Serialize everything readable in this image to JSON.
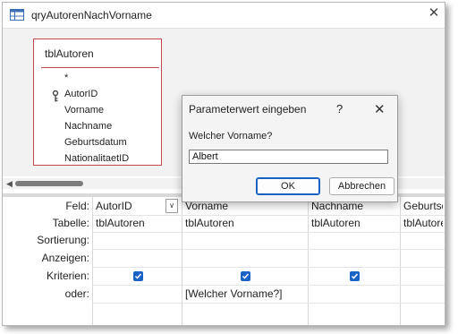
{
  "window": {
    "title": "qryAutorenNachVorname"
  },
  "table": {
    "name": "tblAutoren",
    "fields": [
      "*",
      "AutorID",
      "Vorname",
      "Nachname",
      "Geburtsdatum",
      "NationalitaetID"
    ]
  },
  "grid": {
    "row_labels": [
      "Feld:",
      "Tabelle:",
      "Sortierung:",
      "Anzeigen:",
      "Kriterien:",
      "oder:"
    ],
    "columns": [
      {
        "field": "AutorID",
        "table": "tblAutoren",
        "show": true,
        "criteria": ""
      },
      {
        "field": "Vorname",
        "table": "tblAutoren",
        "show": true,
        "criteria": "[Welcher Vorname?]"
      },
      {
        "field": "Nachname",
        "table": "tblAutoren",
        "show": true,
        "criteria": ""
      },
      {
        "field": "Geburtsdatum",
        "table": "tblAutoren",
        "show": null,
        "criteria": ""
      }
    ]
  },
  "dialog": {
    "title": "Parameterwert eingeben",
    "help": "?",
    "prompt": "Welcher Vorname?",
    "input_value": "Albert",
    "ok_label": "OK",
    "cancel_label": "Abbrechen"
  },
  "colors": {
    "table_border": "#c0474d",
    "checkbox": "#1a62c4"
  }
}
